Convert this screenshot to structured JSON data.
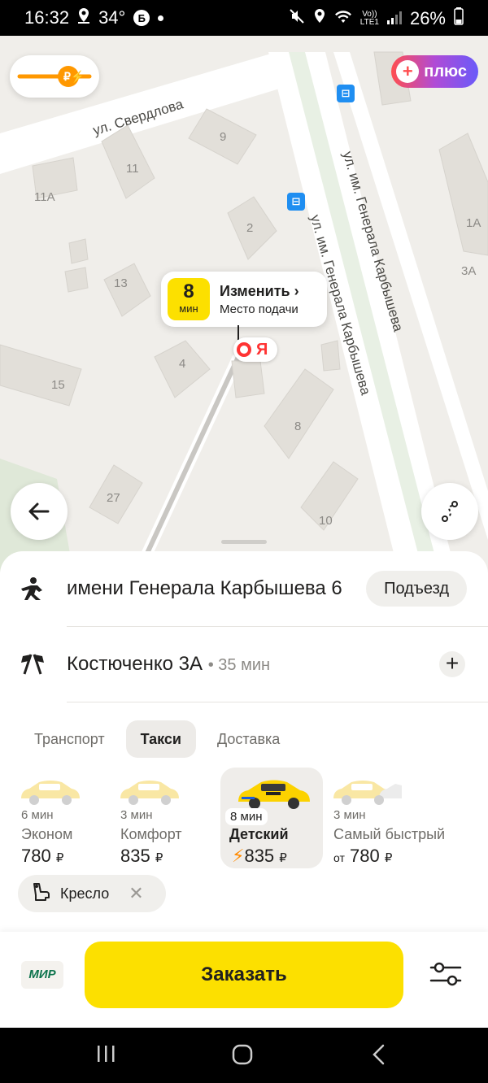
{
  "status_bar": {
    "time": "16:32",
    "temperature": "34°",
    "badge": "Б",
    "network_top": "Vo))",
    "network_bottom": "LTE1",
    "battery": "26%"
  },
  "map": {
    "house_numbers": [
      "9",
      "11",
      "11А",
      "2",
      "13",
      "4",
      "15",
      "8",
      "27",
      "10",
      "1А",
      "3А"
    ],
    "streets": {
      "sverdlova": "ул. Свердлова",
      "karbysheva_1": "ул. им. Генерала Карбышева",
      "karbysheva_2": "ул. им. Генерала Карбышева"
    },
    "plus_label": "плюс",
    "pickup": {
      "minutes": "8",
      "unit": "мин",
      "change_label": "Изменить",
      "place_label": "Место подачи"
    },
    "pin_letter": "Я"
  },
  "route": {
    "from": {
      "address": "имени Генерала Карбышева 6",
      "entrance_label": "Подъезд"
    },
    "to": {
      "address": "Костюченко 3А",
      "duration": "• 35 мин"
    }
  },
  "tabs": [
    {
      "label": "Транспорт",
      "active": false
    },
    {
      "label": "Такси",
      "active": true
    },
    {
      "label": "Доставка",
      "active": false
    }
  ],
  "tariffs": [
    {
      "eta": "6 мин",
      "name": "Эконом",
      "price": "780",
      "currency": "₽",
      "prefix": ""
    },
    {
      "eta": "3 мин",
      "name": "Комфорт",
      "price": "835",
      "currency": "₽",
      "prefix": ""
    },
    {
      "eta": "8 мин",
      "name": "Детский",
      "price": "835",
      "currency": "₽",
      "prefix": "⚡"
    },
    {
      "eta": "3 мин",
      "name": "Самый быстрый",
      "price": "780",
      "currency": "₽",
      "prefix": "от"
    }
  ],
  "options": {
    "seat_label": "Кресло"
  },
  "bottom": {
    "payment_label": "МИР",
    "order_label": "Заказать"
  },
  "colors": {
    "accent_yellow": "#fce000",
    "map_bg": "#f0eeea",
    "building": "#e2dfd9",
    "road": "#ffffff",
    "bolt": "#ff8a00"
  }
}
